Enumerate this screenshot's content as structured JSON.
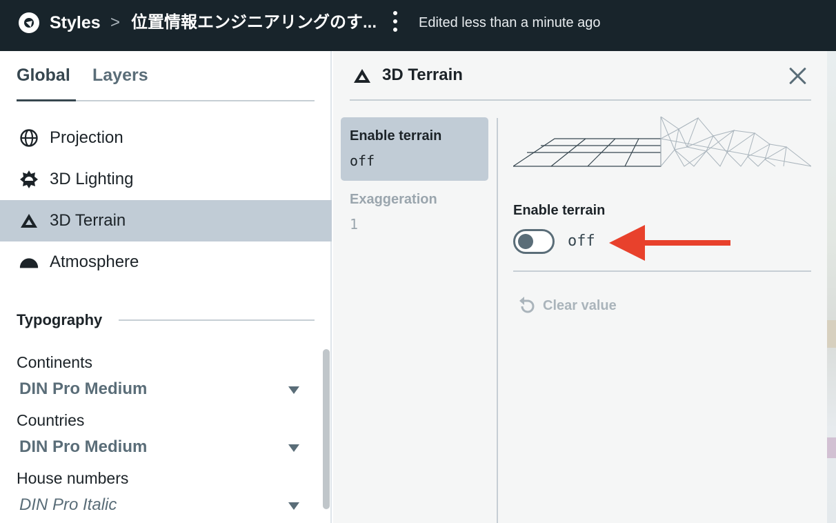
{
  "header": {
    "app_link": "Styles",
    "separator": ">",
    "style_name": "位置情報エンジニアリングのす...",
    "status": "Edited less than a minute ago"
  },
  "sidebar": {
    "tabs": [
      {
        "label": "Global",
        "active": true
      },
      {
        "label": "Layers",
        "active": false
      }
    ],
    "items": [
      {
        "label": "Projection",
        "icon": "globe-icon"
      },
      {
        "label": "3D Lighting",
        "icon": "sun-gear-icon"
      },
      {
        "label": "3D Terrain",
        "icon": "mountain-icon",
        "active": true
      },
      {
        "label": "Atmosphere",
        "icon": "horizon-icon"
      }
    ],
    "typography": {
      "title": "Typography",
      "fonts": [
        {
          "label": "Continents",
          "value": "DIN Pro Medium"
        },
        {
          "label": "Countries",
          "value": "DIN Pro Medium"
        },
        {
          "label": "House numbers",
          "value": "DIN Pro Italic"
        }
      ]
    }
  },
  "panel": {
    "title": "3D Terrain",
    "icon": "mountain-icon",
    "properties": [
      {
        "name": "Enable terrain",
        "value": "off",
        "active": true
      },
      {
        "name": "Exaggeration",
        "value": "1",
        "active": false
      }
    ],
    "detail": {
      "label": "Enable terrain",
      "toggle_state": "off",
      "clear_label": "Clear value"
    }
  },
  "colors": {
    "topbar": "#18242b",
    "active_item": "#c1ccd6",
    "annotation_arrow": "#e8412c"
  }
}
